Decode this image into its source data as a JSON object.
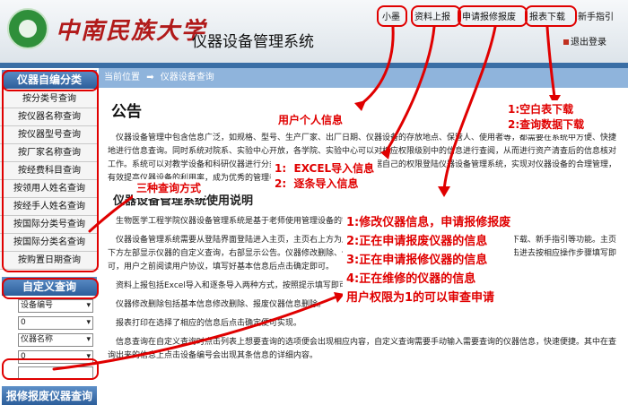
{
  "header": {
    "university": "中南民族大学",
    "system_title": "仪器设备管理系统",
    "nav": [
      "小墨",
      "资料上报",
      "申请报修报废",
      "报表下载",
      "新手指引"
    ],
    "logout": "退出登录"
  },
  "sidebar": {
    "category_title": "仪器自编分类",
    "items": [
      "按分类号查询",
      "按仪器名称查询",
      "按仪器型号查询",
      "按厂家名称查询",
      "按经费科目查询",
      "按领用人姓名查询",
      "按经手人姓名查询",
      "按国际分类号查询",
      "按国际分类名查询",
      "按购置日期查询"
    ],
    "custom_title": "自定义查询",
    "select1": "设备编号",
    "select2": "0",
    "select3": "仪器名称",
    "select4": "0",
    "repair_title": "报修报废仪器查询"
  },
  "breadcrumb": {
    "label": "当前位置",
    "arrow": "➡",
    "page": "仪器设备查询"
  },
  "content": {
    "title": "公告",
    "para1": "仪器设备管理中包含信息广泛，如规格、型号、生产厂家、出厂日期、仪器设备的存放地点、保管人、使用者等，都需要在系统中方便、快捷地进行信息查询。同时系统对院系、实验中心开放，各学院、实验中心可以对相应权限级别中的信息进行查阅，从而进行资产清查后的信息核对工作。系统可以对教学设备和科研仪器进行分类管理，借还操作。请用户根据自己的权限登陆仪器设备管理系统，实现对仪器设备的合理管理，有效提高仪器设备的利用率，成为优秀的管理者。",
    "section_title": "仪器设备管理系统使用说明",
    "para2": "生物医学工程学院仪器设备管理系统是基于老师使用管理设备的需要而开发的。",
    "para3": "仪器设备管理系统需要从登陆界面登陆进入主页，主页右上方为用户信息，包括资料上报、申请报修报废、报表下载、新手指引等功能。主页下方左部显示仪器的自定义查询，右部显示公告。仪器修改删除、仪器信息修改、联系人、添加新用户三部分，点击进去按相应操作步骤填写即可，用户之前阅读用户协议，填写好基本信息后点击确定即可。",
    "para4": "资料上报包括Excel导入和逐条导入两种方式，按照提示填写即可。",
    "para5": "仪器修改删除包括基本信息修改删除、报废仪器信息删除。",
    "para6": "报表打印在选择了相应的信息后点击确定便可实现。",
    "para7": "信息查询在自定义查询时点击列表上想要查询的选项便会出现相应内容，自定义查询需要手动输入需要查询的仪器信息，快速便捷。其中在查询出来的信息上点击设备编号会出现其条信息的详细内容。"
  },
  "annotations": {
    "user_info": "用户个人信息",
    "reports": "1:空白表下载\n2:查询数据下载",
    "upload": "1:  EXCEL导入信息\n2:  逐条导入信息",
    "query_modes": "三种查询方式",
    "repair": "1:修改仪器信息，申请报修报废\n2:正在申请报废仪器的信息\n3:正在申请报修仪器的信息\n4:正在维修的仪器的信息\n用户权限为1的可以审查申请"
  },
  "colors": {
    "annotation": "#e00000",
    "sidebar_head": "#2c5e9a",
    "breadcrumb": "#8fb4dc",
    "brand": "#b11a1a"
  }
}
